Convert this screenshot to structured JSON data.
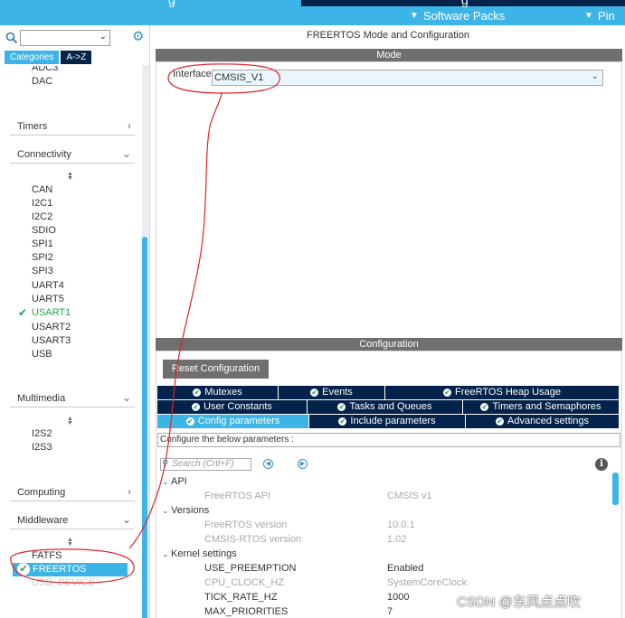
{
  "topbar": {
    "tab_fragment_1": "g",
    "tab_fragment_2": "g",
    "software_packs": "Software Packs",
    "pinout": "Pin"
  },
  "left_panel": {
    "search_value": "",
    "tabs": {
      "categories": "Categories",
      "az": "A->Z"
    },
    "items_top": [
      "ADC3",
      "DAC"
    ],
    "sections": {
      "timers": "Timers",
      "connectivity": "Connectivity",
      "multimedia": "Multimedia",
      "computing": "Computing",
      "middleware": "Middleware"
    },
    "connectivity_items": [
      "CAN",
      "I2C1",
      "I2C2",
      "SDIO",
      "SPI1",
      "SPI2",
      "SPI3",
      "UART4",
      "UART5",
      "USART1",
      "USART2",
      "USART3",
      "USB"
    ],
    "multimedia_items": [
      "I2S2",
      "I2S3"
    ],
    "middleware_items": [
      "FATFS",
      "FREERTOS",
      "USB_DEVICE"
    ]
  },
  "main": {
    "title": "FREERTOS Mode and Configuration",
    "mode_header": "Mode",
    "interface_label": "Interface",
    "interface_value": "CMSIS_V1",
    "config_header": "Configuration",
    "reset_button": "Reset Configuration",
    "tabs_row1": [
      "Mutexes",
      "Events",
      "FreeRTOS Heap Usage"
    ],
    "tabs_row2": [
      "User Constants",
      "Tasks and Queues",
      "Timers and Semaphores"
    ],
    "tabs_row3": [
      "Config parameters",
      "Include parameters",
      "Advanced settings"
    ],
    "configure_hint": "Configure the below parameters :",
    "search_placeholder": "Search (Crtl+F)",
    "groups": {
      "api": "API",
      "versions": "Versions",
      "kernel": "Kernel settings"
    },
    "params": [
      {
        "name": "FreeRTOS API",
        "value": "CMSIS v1"
      },
      {
        "name": "FreeRTOS version",
        "value": "10.0.1"
      },
      {
        "name": "CMSIS-RTOS version",
        "value": "1.02"
      },
      {
        "name": "USE_PREEMPTION",
        "value": "Enabled"
      },
      {
        "name": "CPU_CLOCK_HZ",
        "value": "SystemCoreClock"
      },
      {
        "name": "TICK_RATE_HZ",
        "value": "1000"
      },
      {
        "name": "MAX_PRIORITIES",
        "value": "7"
      }
    ]
  },
  "watermark": "CSDN @东风点点吹",
  "colors": {
    "accent": "#3cb4e6",
    "navy": "#03234b",
    "header_gray": "#6f6f6f",
    "check_green": "#2aa04a",
    "annotation_red": "#e0242a"
  }
}
